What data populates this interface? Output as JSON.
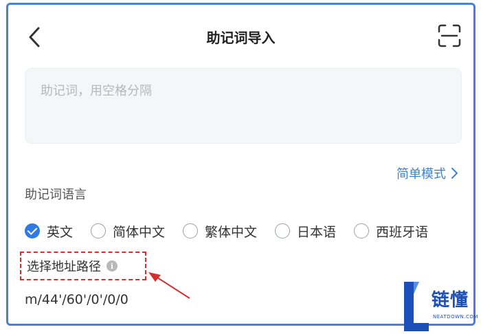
{
  "header": {
    "title": "助记词导入",
    "back_icon": "chevron-left-icon",
    "scan_icon": "scan-icon"
  },
  "mnemonic": {
    "placeholder": "助记词，用空格分隔",
    "value": ""
  },
  "simple_mode": {
    "label": "简单模式",
    "icon": "chevron-right-icon"
  },
  "language_section": {
    "label": "助记词语言",
    "options": [
      {
        "label": "英文",
        "checked": true
      },
      {
        "label": "简体中文",
        "checked": false
      },
      {
        "label": "繁体中文",
        "checked": false
      },
      {
        "label": "日本语",
        "checked": false
      },
      {
        "label": "西班牙语",
        "checked": false
      }
    ]
  },
  "path_section": {
    "label": "选择地址路径",
    "info_icon": "info-icon",
    "value": "m/44'/60'/0'/0/0"
  },
  "watermark": {
    "text": "链懂",
    "sub": "NEATDOWN.COM"
  },
  "colors": {
    "accent": "#2f7be5",
    "link": "#3b82d6",
    "annotation": "#d92c2c",
    "frame": "#4a7fd6"
  }
}
